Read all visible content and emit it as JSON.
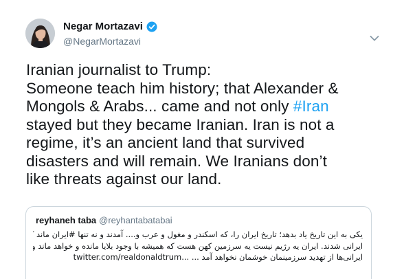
{
  "author": {
    "display_name": "Negar Mortazavi",
    "handle": "@NegarMortazavi"
  },
  "tweet": {
    "line1": "Iranian journalist to Trump:",
    "line2": "Someone teach him history; that Alexander &",
    "line3_before": "Mongols & Arabs... came and not only ",
    "hashtag": "#Iran",
    "line4": "stayed but they became Iranian. Iran is not a",
    "line5": "regime, it’s an ancient land that survived",
    "line6": "disasters and will remain. We Iranians don’t",
    "line7": "like threats against our land."
  },
  "quoted": {
    "display_name": "reyhaneh taba",
    "handle": "@reyhantabatabai",
    "line1": "یکی به این تاریخ یاد بدهد؛ تاریخ ایران را، که اسکندر و مغول و عرب و.... آمدند و نه تنها #ایران ماند که آنها هم",
    "line2": "ایرانی شدند. ایران یه رژیم نیست یه سرزمین کهن هست که همیشه با وجود بلایا مانده و خواهد ماند و نهایتا اینکه ما",
    "line3_text": "ایرانی‌ها از تهدید سرزمینمان خوشمان نخواهد آمد ...",
    "line3_link": "twitter.com/realdonaldtrum..."
  },
  "colors": {
    "hashtag": "#1da1f2",
    "verified": "#1da1f2",
    "secondary_text": "#657786"
  }
}
